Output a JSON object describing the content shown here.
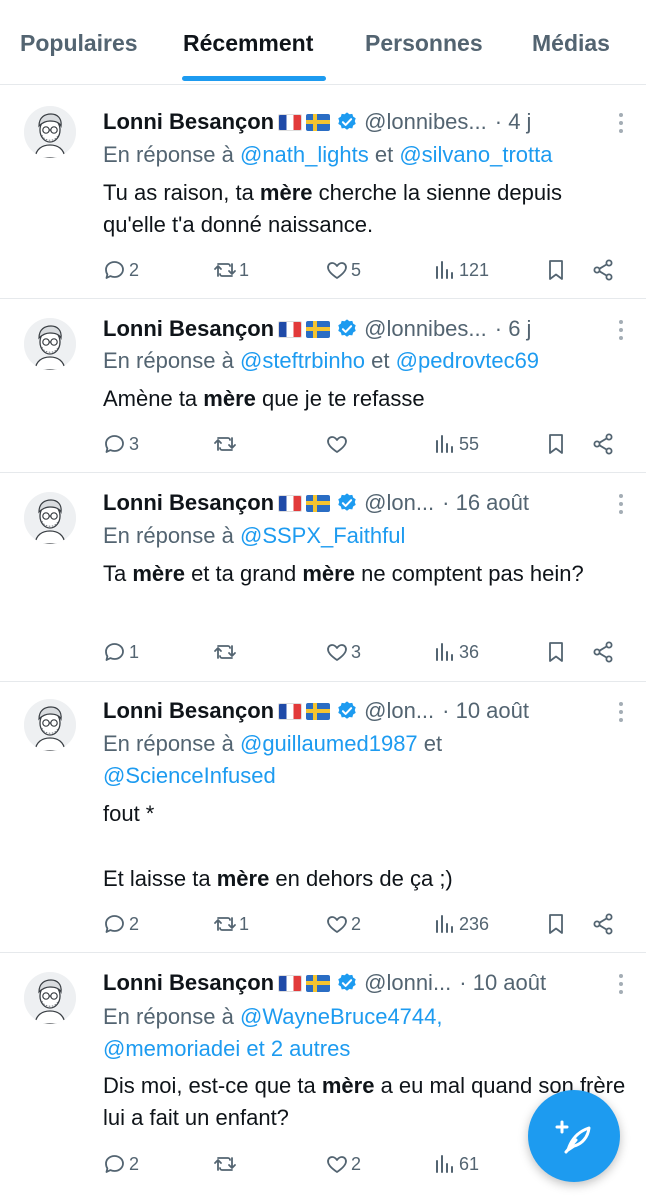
{
  "tabs": [
    {
      "label": "Populaires"
    },
    {
      "label": "Récemment"
    },
    {
      "label": "Personnes"
    },
    {
      "label": "Médias"
    }
  ],
  "active_tab": "Récemment",
  "colors": {
    "accent": "#1d9bf0",
    "muted": "#536471",
    "text": "#0f1419"
  },
  "tweets": [
    {
      "name": "Lonni Besançon",
      "flags": [
        "fr-flag",
        "se-flag"
      ],
      "handle": "@lonnibes...",
      "time": "· 4 j",
      "reply_prefix": "En réponse à ",
      "mention_1": "@nath_lights",
      "joiner": " et ",
      "mention_2": "@silvano_trotta",
      "text_1": "Tu as raison, ta ",
      "bold_1": "mère",
      "text_2": " cherche la sienne depuis qu'elle t'a donné naissance.",
      "replies": "2",
      "retweets": "1",
      "likes": "5",
      "views": "121"
    },
    {
      "name": "Lonni Besançon",
      "flags": [
        "fr-flag",
        "se-flag"
      ],
      "handle": "@lonnibes...",
      "time": "· 6 j",
      "reply_prefix": "En réponse à ",
      "mention_1": "@steftrbinho",
      "joiner": " et ",
      "mention_2": "@pedrovtec69",
      "text_1": "Amène ta ",
      "bold_1": "mère",
      "text_2": " que je te refasse",
      "replies": "3",
      "retweets": "",
      "likes": "",
      "views": "55"
    },
    {
      "name": "Lonni Besançon",
      "flags": [
        "fr-flag",
        "se-flag"
      ],
      "handle": "@lon...",
      "time": "· 16 août",
      "reply_prefix": "En réponse à ",
      "mention_1": "@SSPX_Faithful",
      "text_1": "Ta ",
      "bold_1": "mère",
      "text_2": " et ta grand ",
      "bold_2": "mère",
      "text_3": " ne comptent pas hein?",
      "replies": "1",
      "retweets": "",
      "likes": "3",
      "views": "36"
    },
    {
      "name": "Lonni Besançon",
      "flags": [
        "fr-flag",
        "se-flag"
      ],
      "handle": "@lon...",
      "time": "· 10 août",
      "reply_prefix": "En réponse à ",
      "mention_1": "@guillaumed1987",
      "joiner": " et",
      "mention_2": "@ScienceInfused",
      "line_1": "fout *",
      "text_1": "Et laisse ta ",
      "bold_1": "mère",
      "text_2": " en dehors de ça ;)",
      "replies": "2",
      "retweets": "1",
      "likes": "2",
      "views": "236"
    },
    {
      "name": "Lonni Besançon",
      "flags": [
        "fr-flag",
        "se-flag"
      ],
      "handle": "@lonni...",
      "time": "· 10 août",
      "reply_prefix": "En réponse à ",
      "mention_1": "@WayneBruce4744,",
      "mention_2": "@memoriadei et 2 autres",
      "text_1": "Dis moi, est-ce que ta ",
      "bold_1": "mère",
      "text_2": " a eu mal quand son frère lui a fait un enfant?",
      "replies": "2",
      "retweets": "",
      "likes": "2",
      "views": "61"
    }
  ],
  "fab": {
    "icon": "compose-feather-icon"
  }
}
